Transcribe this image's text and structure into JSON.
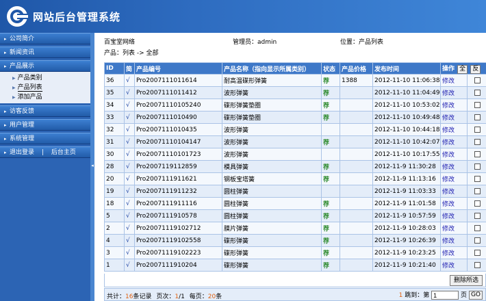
{
  "header": {
    "title": "网站后台管理系统"
  },
  "sidebar": {
    "menus": [
      {
        "label": "公司简介"
      },
      {
        "label": "新闻资讯"
      },
      {
        "label": "产品展示"
      },
      {
        "label": "访客反馈"
      },
      {
        "label": "用户管理"
      },
      {
        "label": "系统管理"
      }
    ],
    "product_submenu": [
      {
        "label": "产品类别"
      },
      {
        "label": "产品列表"
      },
      {
        "label": "添加产品"
      }
    ],
    "logout": "退出登录",
    "separator": "|",
    "home": "后台主页"
  },
  "topbar": {
    "site": "百宝堂网络",
    "admin": "管理员：admin",
    "location": "位置：产品列表"
  },
  "breadcrumb": "产品：列表 -> 全部",
  "table": {
    "headers": {
      "id": "ID",
      "simple": "简",
      "code": "产品编号",
      "name": "产品名称（指向显示所属类别）",
      "status": "状态",
      "price": "产品价格",
      "time": "发布时间",
      "op": "操作",
      "all": "全",
      "invert": "反"
    },
    "rows": [
      {
        "id": "36",
        "check": "√",
        "code": "Pro2007111011614",
        "name": "耐高温碟形弹簧",
        "status": "荐",
        "price": "1388",
        "time": "2012-11-10 11:06:38",
        "op": "修改"
      },
      {
        "id": "35",
        "check": "√",
        "code": "Pro2007111011412",
        "name": "波形弹簧",
        "status": "荐",
        "price": "",
        "time": "2012-11-10 11:04:49",
        "op": "修改"
      },
      {
        "id": "34",
        "check": "√",
        "code": "Pro20071110105240",
        "name": "碟形弹簧垫圈",
        "status": "荐",
        "price": "",
        "time": "2012-11-10 10:53:02",
        "op": "修改"
      },
      {
        "id": "33",
        "check": "√",
        "code": "Pro2007111010490",
        "name": "碟形弹簧垫圈",
        "status": "荐",
        "price": "",
        "time": "2012-11-10 10:49:48",
        "op": "修改"
      },
      {
        "id": "32",
        "check": "√",
        "code": "Pro2007111010435",
        "name": "波形弹簧",
        "status": "",
        "price": "",
        "time": "2012-11-10 10:44:18",
        "op": "修改"
      },
      {
        "id": "31",
        "check": "√",
        "code": "Pro20071110104147",
        "name": "波形弹簧",
        "status": "荐",
        "price": "",
        "time": "2012-11-10 10:42:07",
        "op": "修改"
      },
      {
        "id": "30",
        "check": "√",
        "code": "Pro20071110101723",
        "name": "波形弹簧",
        "status": "",
        "price": "",
        "time": "2012-11-10 10:17:55",
        "op": "修改"
      },
      {
        "id": "28",
        "check": "√",
        "code": "Pro2007119112859",
        "name": "模具弹簧",
        "status": "荐",
        "price": "",
        "time": "2012-11-9 11:30:28",
        "op": "修改"
      },
      {
        "id": "20",
        "check": "√",
        "code": "Pro2007111911621",
        "name": "钢板宝塔簧",
        "status": "荐",
        "price": "",
        "time": "2012-11-9 11:13:16",
        "op": "修改"
      },
      {
        "id": "19",
        "check": "√",
        "code": "Pro2007111911232",
        "name": "圆柱弹簧",
        "status": "",
        "price": "",
        "time": "2012-11-9 11:03:33",
        "op": "修改"
      },
      {
        "id": "18",
        "check": "√",
        "code": "Pro2007111911116",
        "name": "圆柱弹簧",
        "status": "荐",
        "price": "",
        "time": "2012-11-9 11:01:58",
        "op": "修改"
      },
      {
        "id": "5",
        "check": "√",
        "code": "Pro2007111910578",
        "name": "圆柱弹簧",
        "status": "荐",
        "price": "",
        "time": "2012-11-9 10:57:59",
        "op": "修改"
      },
      {
        "id": "2",
        "check": "√",
        "code": "Pro20071119102712",
        "name": "膜片弹簧",
        "status": "荐",
        "price": "",
        "time": "2012-11-9 10:28:03",
        "op": "修改"
      },
      {
        "id": "4",
        "check": "√",
        "code": "Pro20071119102558",
        "name": "碟形弹簧",
        "status": "荐",
        "price": "",
        "time": "2012-11-9 10:26:39",
        "op": "修改"
      },
      {
        "id": "3",
        "check": "√",
        "code": "Pro20071119102223",
        "name": "碟形弹簧",
        "status": "荐",
        "price": "",
        "time": "2012-11-9 10:23:25",
        "op": "修改"
      },
      {
        "id": "1",
        "check": "√",
        "code": "Pro2007111910204",
        "name": "碟形弹簧",
        "status": "荐",
        "price": "",
        "time": "2012-11-9 10:21:40",
        "op": "修改"
      }
    ]
  },
  "delete_button": "删除所选",
  "footer": {
    "total_prefix": "共计：",
    "total_count": "16",
    "total_suffix": "条记录",
    "page_prefix": "页次：",
    "page_current": "1",
    "page_total": "/1",
    "per_prefix": "每页：",
    "per_count": "20",
    "per_suffix": "条",
    "jump_page": "1",
    "jump_label": "跳到：第",
    "jump_value": "1",
    "page_unit": "页",
    "go": "GO"
  },
  "colors": {
    "header": "#2e6cc0",
    "sidebar": "#2c64b4",
    "table_header": "#3e78c8",
    "recommend": "#2e8b2e",
    "count": "#e06010"
  }
}
